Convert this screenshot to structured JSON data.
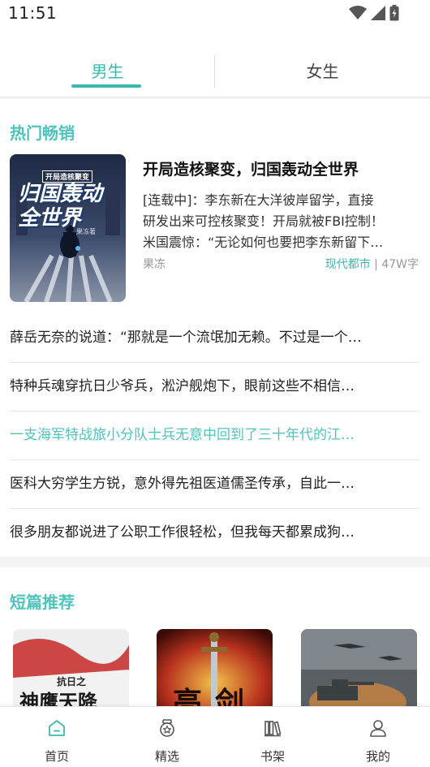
{
  "status_bar": {
    "time": "11:51",
    "icons": [
      "wifi-icon",
      "signal-icon",
      "battery-icon"
    ]
  },
  "tabs": [
    {
      "label": "男生",
      "selected": true
    },
    {
      "label": "女生",
      "selected": false
    }
  ],
  "hot": {
    "title": "热门畅销",
    "featured": {
      "cover_title_small": "开局造核聚变",
      "cover_title_big": "归国轰动全世界",
      "cover_author": "果冻著",
      "title": "开局造核聚变，归国轰动全世界",
      "desc_lines": [
        "[连载中]：李东新在大洋彼岸留学，直接",
        "研发出来可控核聚变！开局就被FBI控制！",
        "米国震惊：“无论如何也要把李东新留下…"
      ],
      "author": "果冻",
      "genre": "现代都市",
      "separator": "|",
      "word_count": "47W字"
    },
    "list": [
      {
        "text": "薛岳无奈的说道：“那就是一个流氓加无赖。不过是一个…",
        "highlight": false
      },
      {
        "text": "特种兵魂穿抗日少爷兵，淞沪舰炮下，眼前这些不相信…",
        "highlight": false
      },
      {
        "text": "一支海军特战旅小分队士兵无意中回到了三十年代的江…",
        "highlight": true
      },
      {
        "text": "医科大穷学生方锐，意外得先祖医道儒圣传承，自此一…",
        "highlight": false
      },
      {
        "text": "很多朋友都说进了公职工作很轻松，但我每天都累成狗…",
        "highlight": false
      }
    ]
  },
  "short": {
    "title": "短篇推荐",
    "covers": [
      {
        "small": "抗日之",
        "big": "神鹰天降"
      },
      {
        "big": "亮剑"
      },
      {
        "big": ""
      }
    ]
  },
  "bottom_nav": [
    {
      "label": "首页",
      "icon": "home-icon",
      "active": true
    },
    {
      "label": "精选",
      "icon": "featured-icon",
      "active": false
    },
    {
      "label": "书架",
      "icon": "bookshelf-icon",
      "active": false
    },
    {
      "label": "我的",
      "icon": "profile-icon",
      "active": false
    }
  ],
  "colors": {
    "accent": "#3db8b0",
    "section_title": "#4fc3bc",
    "text": "#222222",
    "muted": "#999999"
  }
}
